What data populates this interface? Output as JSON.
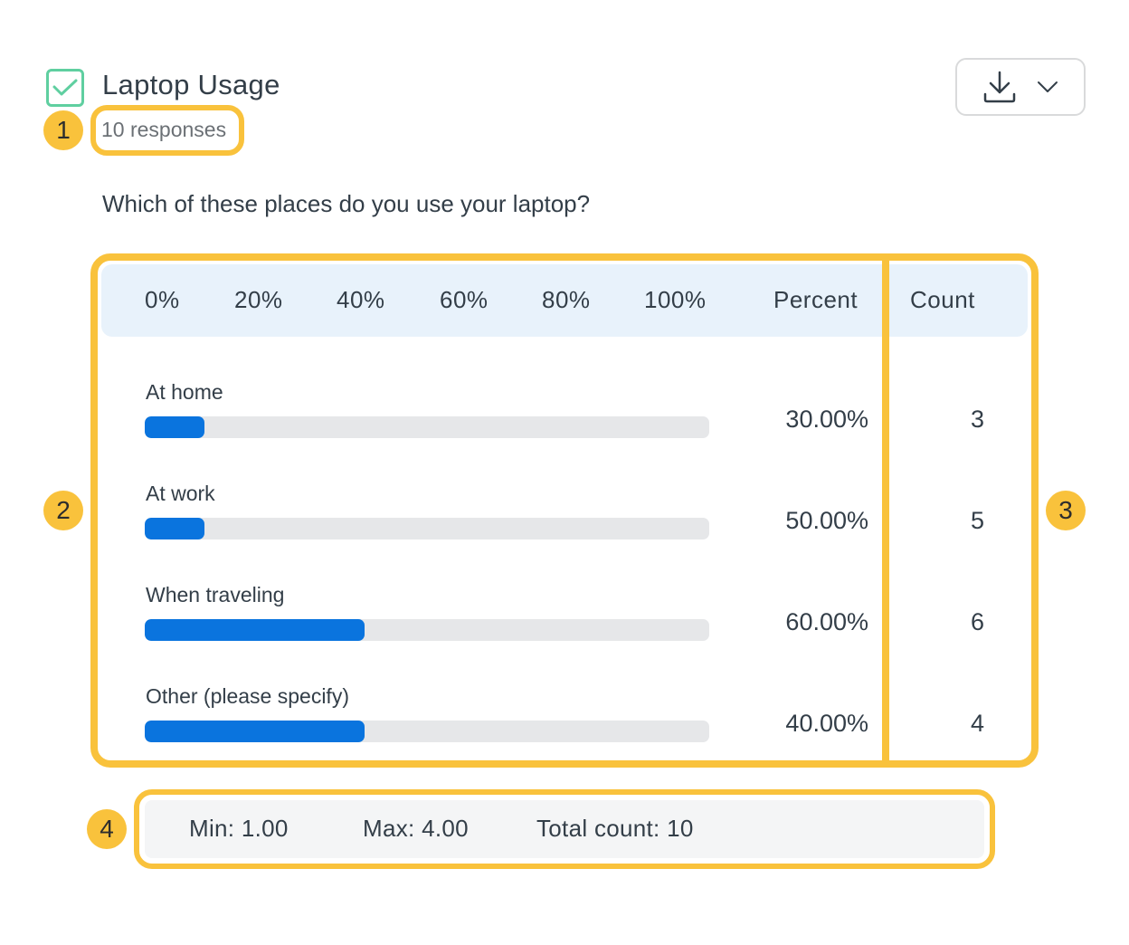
{
  "question_card": {
    "title": "Laptop Usage",
    "responses": "10 responses",
    "question": "Which of these places do you use your laptop?",
    "download_icon": "download-icon",
    "chevron_icon": "chevron-down-icon",
    "checkbox_icon": "checkmark-icon"
  },
  "annotations": [
    "1",
    "2",
    "3",
    "4"
  ],
  "colors": {
    "accent_bar": "#0a74de",
    "highlight": "#f9c23c",
    "checkbox": "#5fcfa0",
    "header_band": "#e8f2fb"
  },
  "table": {
    "axis_ticks": [
      "0%",
      "20%",
      "40%",
      "60%",
      "80%",
      "100%"
    ],
    "percent_header": "Percent",
    "count_header": "Count",
    "rows": [
      {
        "label": "At home",
        "percent": "30.00%",
        "count": "3",
        "bar_fill": 0.105
      },
      {
        "label": "At work",
        "percent": "50.00%",
        "count": "5",
        "bar_fill": 0.105
      },
      {
        "label": "When traveling",
        "percent": "60.00%",
        "count": "6",
        "bar_fill": 0.39
      },
      {
        "label": "Other (please specify)",
        "percent": "40.00%",
        "count": "4",
        "bar_fill": 0.39
      }
    ]
  },
  "stats": {
    "min": "Min: 1.00",
    "max": "Max: 4.00",
    "total": "Total count: 10"
  }
}
